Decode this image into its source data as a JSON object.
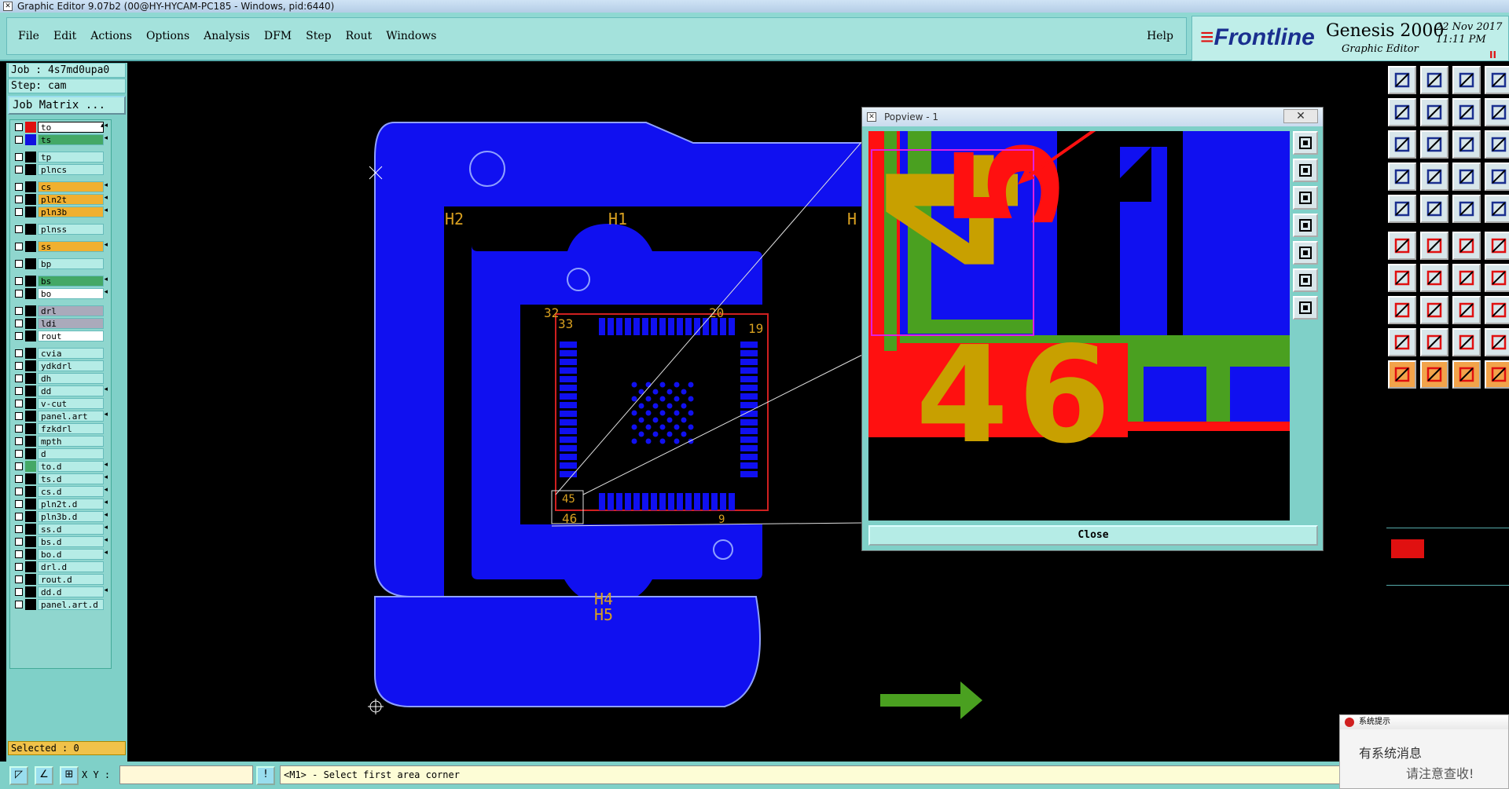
{
  "window": {
    "title": "Graphic Editor 9.07b2 (00@HY-HYCAM-PC185 - Windows, pid:6440)"
  },
  "menu": {
    "items": [
      "File",
      "Edit",
      "Actions",
      "Options",
      "Analysis",
      "DFM",
      "Step",
      "Rout",
      "Windows"
    ],
    "help": "Help"
  },
  "brand": {
    "logo": "Frontline",
    "product": "Genesis 2000",
    "subtitle": "Graphic Editor",
    "date": "22 Nov 2017",
    "time": "11:11 PM",
    "pause": "II"
  },
  "job": {
    "job_line": "Job : 4s7md0upa0",
    "step_line": "Step: cam",
    "matrix_button": "Job Matrix ..."
  },
  "layers": [
    {
      "name": "to",
      "style": "sel",
      "color": "#e01010",
      "arrow": "▴◂"
    },
    {
      "name": "ts",
      "style": "green",
      "color": "#1010e0",
      "arrow": "◂"
    },
    {
      "name": "tp",
      "style": "",
      "color": "#000000",
      "arrow": ""
    },
    {
      "name": "plncs",
      "style": "",
      "color": "#000000",
      "arrow": ""
    },
    {
      "name": "cs",
      "style": "yellow",
      "color": "#000000",
      "arrow": "◂"
    },
    {
      "name": "pln2t",
      "style": "yellow",
      "color": "#000000",
      "arrow": "◂"
    },
    {
      "name": "pln3b",
      "style": "yellow",
      "color": "#000000",
      "arrow": "◂"
    },
    {
      "name": "plnss",
      "style": "",
      "color": "#000000",
      "arrow": ""
    },
    {
      "name": "ss",
      "style": "yellow",
      "color": "#000000",
      "arrow": "◂"
    },
    {
      "name": "bp",
      "style": "",
      "color": "#000000",
      "arrow": ""
    },
    {
      "name": "bs",
      "style": "green",
      "color": "#000000",
      "arrow": "◂"
    },
    {
      "name": "bo",
      "style": "white",
      "color": "#000000",
      "arrow": "◂"
    },
    {
      "name": "drl",
      "style": "gray",
      "color": "#000000",
      "arrow": ""
    },
    {
      "name": "ldi",
      "style": "gray",
      "color": "#000000",
      "arrow": ""
    },
    {
      "name": "rout",
      "style": "white",
      "color": "#000000",
      "arrow": ""
    },
    {
      "name": "cvia",
      "style": "",
      "color": "#000000",
      "arrow": ""
    },
    {
      "name": "ydkdrl",
      "style": "",
      "color": "#000000",
      "arrow": ""
    },
    {
      "name": "dh",
      "style": "",
      "color": "#000000",
      "arrow": ""
    },
    {
      "name": "dd",
      "style": "",
      "color": "#000000",
      "arrow": "◂"
    },
    {
      "name": "v-cut",
      "style": "",
      "color": "#000000",
      "arrow": ""
    },
    {
      "name": "panel.art",
      "style": "",
      "color": "#000000",
      "arrow": "◂"
    },
    {
      "name": "fzkdrl",
      "style": "",
      "color": "#000000",
      "arrow": ""
    },
    {
      "name": "mpth",
      "style": "",
      "color": "#000000",
      "arrow": ""
    },
    {
      "name": "d",
      "style": "",
      "color": "#000000",
      "arrow": ""
    },
    {
      "name": "to.d",
      "style": "",
      "color": "#44a866",
      "arrow": "◂"
    },
    {
      "name": "ts.d",
      "style": "",
      "color": "#000000",
      "arrow": "◂"
    },
    {
      "name": "cs.d",
      "style": "",
      "color": "#000000",
      "arrow": "◂"
    },
    {
      "name": "pln2t.d",
      "style": "",
      "color": "#000000",
      "arrow": "◂"
    },
    {
      "name": "pln3b.d",
      "style": "",
      "color": "#000000",
      "arrow": "◂"
    },
    {
      "name": "ss.d",
      "style": "",
      "color": "#000000",
      "arrow": "◂"
    },
    {
      "name": "bs.d",
      "style": "",
      "color": "#000000",
      "arrow": "◂"
    },
    {
      "name": "bo.d",
      "style": "",
      "color": "#000000",
      "arrow": "◂"
    },
    {
      "name": "drl.d",
      "style": "",
      "color": "#000000",
      "arrow": ""
    },
    {
      "name": "rout.d",
      "style": "",
      "color": "#000000",
      "arrow": ""
    },
    {
      "name": "dd.d",
      "style": "",
      "color": "#000000",
      "arrow": "◂"
    },
    {
      "name": "panel.art.d",
      "style": "",
      "color": "#000000",
      "arrow": ""
    }
  ],
  "status": {
    "selected": "Selected : 0",
    "xy_label": "X Y :",
    "xy_value": "",
    "message": "<M1> - Select first area corner"
  },
  "canvas": {
    "labels": [
      "H2",
      "H1",
      "H",
      "H4",
      "H5",
      "33",
      "20",
      "32",
      "19",
      "9",
      "46",
      "45"
    ]
  },
  "popview": {
    "title": "Popview - 1",
    "close_x": "✕",
    "close_button": "Close",
    "digits": [
      "4",
      "5",
      "4",
      "6"
    ]
  },
  "notification": {
    "title": "系统提示",
    "line1": "有系统消息",
    "line2": "请注意查收!"
  },
  "colors": {
    "board": "#1010f0",
    "silkscreen": "#c8a000",
    "copper_red": "#ff1010",
    "mask_green": "#4aa020",
    "panel_bg": "#7fd0c8"
  }
}
